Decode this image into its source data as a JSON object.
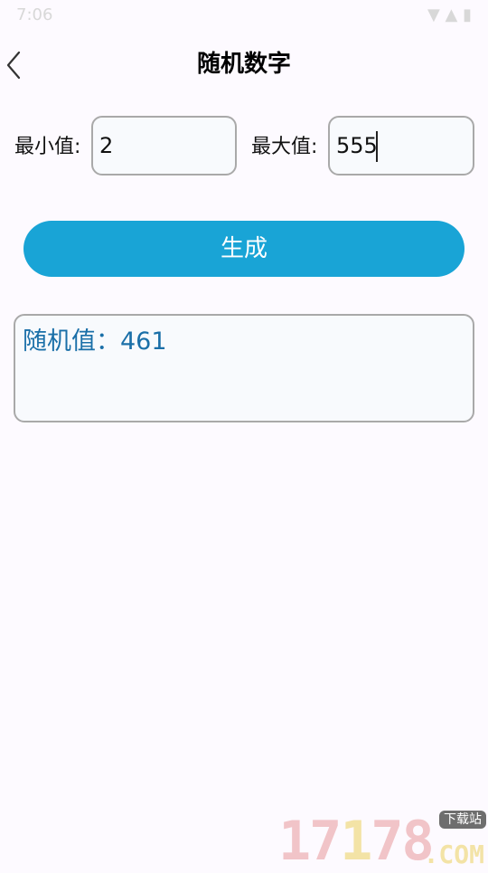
{
  "status_bar": {
    "time": "7:06",
    "icons": "▼ ▲ ▮"
  },
  "header": {
    "title": "随机数字",
    "back_icon": "chevron-left-icon"
  },
  "form": {
    "min": {
      "label": "最小值:",
      "value": "2"
    },
    "max": {
      "label": "最大值:",
      "value": "555"
    }
  },
  "actions": {
    "generate_label": "生成"
  },
  "result": {
    "text": "随机值：461"
  },
  "watermark": {
    "digits_a": "17",
    "digits_b": "1",
    "digits_c": "78",
    "badge": "下载站",
    "suffix": ".COM"
  },
  "colors": {
    "accent": "#19a4d6",
    "result_text": "#1a6fa8",
    "background": "#fdfaff",
    "field_border": "#a9a9a9"
  }
}
